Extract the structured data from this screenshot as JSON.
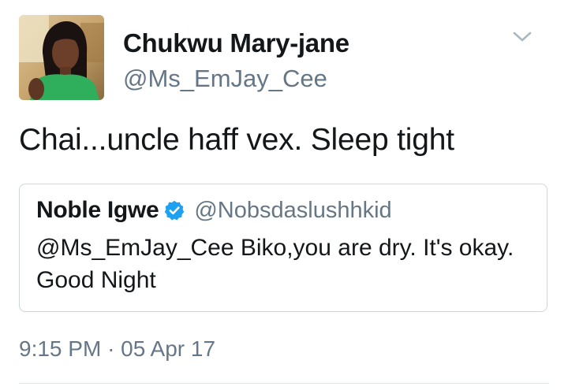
{
  "author": {
    "display_name": "Chukwu Mary-jane",
    "handle": "@Ms_EmJay_Cee"
  },
  "tweet": {
    "text": "Chai...uncle haff vex. Sleep tight",
    "time": "9:15 PM",
    "separator": "·",
    "date": "05 Apr 17"
  },
  "quoted_tweet": {
    "display_name": "Noble Igwe",
    "handle": "@Nobsdaslushhkid",
    "text": "@Ms_EmJay_Cee Biko,you are dry. It's okay. Good Night"
  },
  "icons": {
    "menu": "chevron-down-icon",
    "verified": "verified-badge-icon"
  },
  "colors": {
    "primary_text": "#14171a",
    "secondary_text": "#657786",
    "border": "#ccd6dd",
    "verified_blue": "#1da1f2"
  }
}
